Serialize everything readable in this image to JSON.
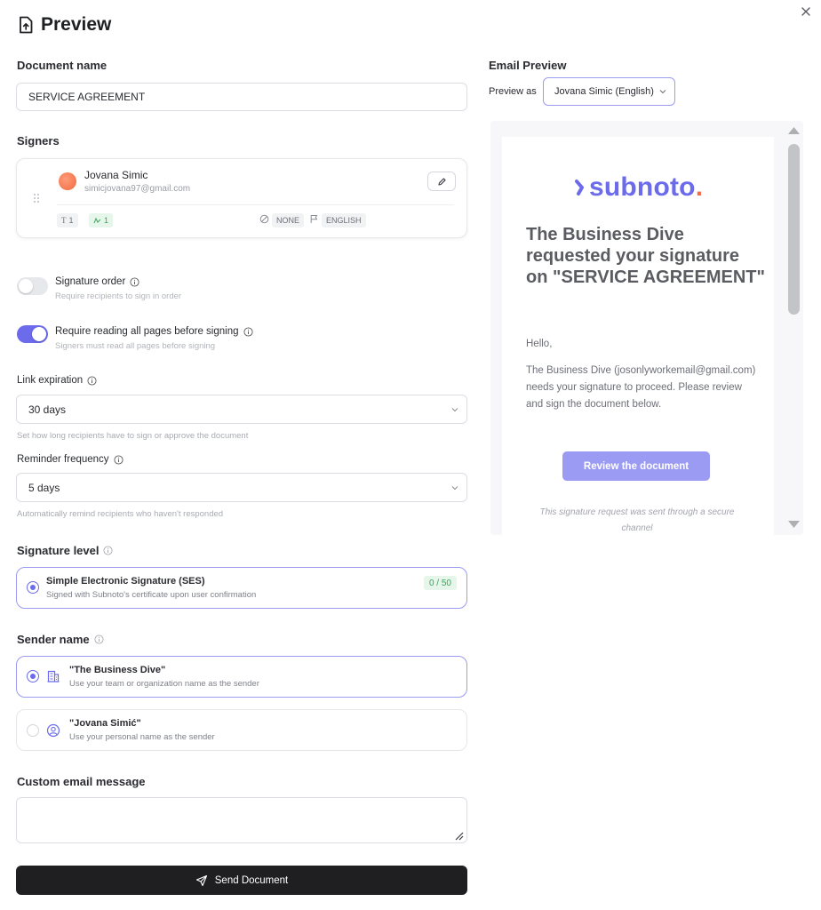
{
  "header": {
    "title": "Preview"
  },
  "document": {
    "label": "Document name",
    "value": "SERVICE AGREEMENT"
  },
  "signers": {
    "label": "Signers",
    "items": [
      {
        "name": "Jovana Simic",
        "email": "simicjovana97@gmail.com",
        "text_fields": "1",
        "sign_fields": "1",
        "auth": "NONE",
        "language": "ENGLISH"
      }
    ]
  },
  "signature_order": {
    "title": "Signature order",
    "subtitle": "Require recipients to sign in order",
    "enabled": false
  },
  "require_reading": {
    "title": "Require reading all pages before signing",
    "subtitle": "Signers must read all pages before signing",
    "enabled": true
  },
  "link_expiration": {
    "label": "Link expiration",
    "value": "30 days",
    "hint": "Set how long recipients have to sign or approve the document"
  },
  "reminder_frequency": {
    "label": "Reminder frequency",
    "value": "5 days",
    "hint": "Automatically remind recipients who haven't responded"
  },
  "signature_level": {
    "label": "Signature level",
    "option": {
      "title": "Simple Electronic Signature (SES)",
      "subtitle": "Signed with Subnoto's certificate upon user confirmation",
      "count": "0 / 50"
    }
  },
  "sender_name": {
    "label": "Sender name",
    "options": [
      {
        "title": "\"The Business Dive\"",
        "subtitle": "Use your team or organization name as the sender",
        "selected": true
      },
      {
        "title": "\"Jovana Simić\"",
        "subtitle": "Use your personal name as the sender",
        "selected": false
      }
    ]
  },
  "custom_message": {
    "label": "Custom email message",
    "value": ""
  },
  "send_button": {
    "label": "Send Document"
  },
  "email_preview": {
    "label": "Email Preview",
    "preview_as_label": "Preview as",
    "preview_as_value": "Jovana Simic (English)",
    "logo": "subnoto",
    "logo_dot": ".",
    "headline": "The Business Dive requested your signature on \"SERVICE AGREEMENT\"",
    "greeting": "Hello,",
    "body": "The Business Dive (josonlyworkemail@gmail.com) needs your signature to proceed. Please review and sign the document below.",
    "button": "Review the document",
    "footer": "This signature request was sent through a secure channel"
  },
  "colors": {
    "accent": "#6b6bec",
    "accent_light": "#9b9bf4",
    "logo_dot": "#f26b4a",
    "success": "#3aa55a",
    "dark_button": "#1f1f21"
  }
}
